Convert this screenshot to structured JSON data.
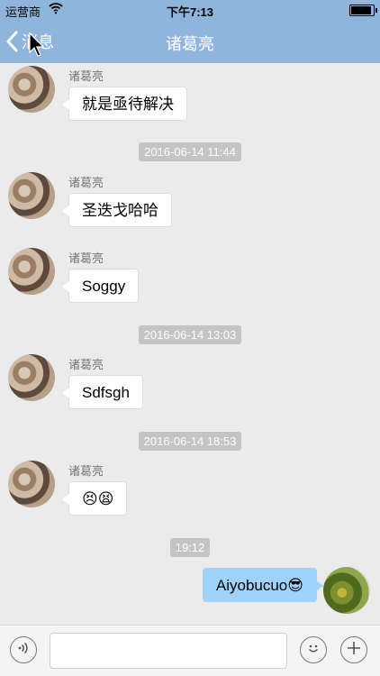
{
  "status_bar": {
    "carrier": "运营商",
    "time": "下午7:13",
    "battery_level": 1.0
  },
  "nav": {
    "back_label": "消息",
    "title": "诸葛亮"
  },
  "messages": [
    {
      "sender": "诸葛亮",
      "text": "就是亟待解决"
    },
    {
      "timestamp": "2016-06-14 11:44"
    },
    {
      "sender": "诸葛亮",
      "text": "圣迭戈哈哈"
    },
    {
      "sender": "诸葛亮",
      "text": "Soggy"
    },
    {
      "timestamp": "2016-06-14 13:03"
    },
    {
      "sender": "诸葛亮",
      "text": "Sdfsgh"
    },
    {
      "timestamp": "2016-06-14 18:53"
    },
    {
      "sender": "诸葛亮",
      "text": "😣😫"
    },
    {
      "timestamp": "19:12"
    },
    {
      "self": true,
      "text": "Aiyobucuo😎"
    }
  ],
  "input_bar": {
    "voice_icon": "voice-icon",
    "emoji_icon": "smiley-icon",
    "add_icon": "plus-icon",
    "placeholder": ""
  },
  "colors": {
    "nav_background": "#8fb5dd",
    "self_bubble": "#9fd3fb",
    "timestamp_pill": "#c4c4c4",
    "chat_background": "#ebebeb"
  }
}
